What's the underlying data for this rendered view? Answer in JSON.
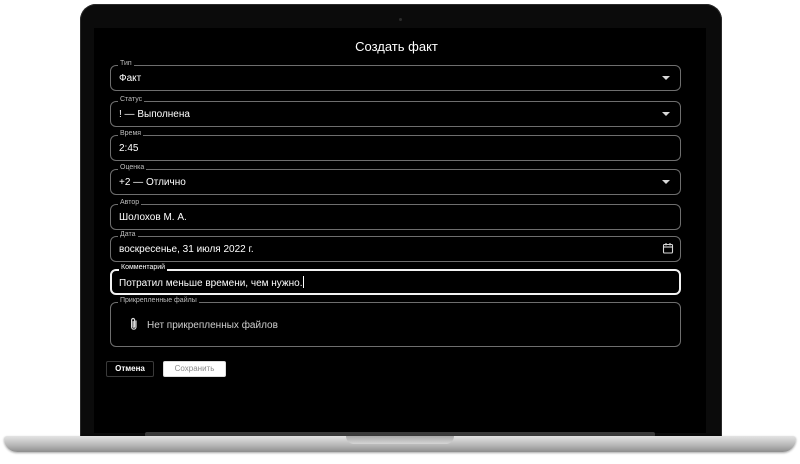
{
  "dialog": {
    "title": "Создать факт"
  },
  "fields": {
    "type": {
      "label": "Тип",
      "value": "Факт"
    },
    "status": {
      "label": "Статус",
      "value": "! — Выполнена"
    },
    "time": {
      "label": "Время",
      "value": "2:45"
    },
    "grade": {
      "label": "Оценка",
      "value": "+2 — Отлично"
    },
    "author": {
      "label": "Автор",
      "value": "Шолохов М. А."
    },
    "date": {
      "label": "Дата",
      "value": "воскресенье, 31 июля 2022 г."
    },
    "comment": {
      "label": "Комментарий",
      "value": "Потратил меньше времени, чем нужно."
    }
  },
  "attachments": {
    "label": "Прикрепленные файлы",
    "empty_text": "Нет прикрепленных файлов"
  },
  "buttons": {
    "cancel": "Отмена",
    "save": "Сохранить"
  },
  "icons": {
    "dropdown": "chevron-down-icon",
    "date": "calendar-icon",
    "attachment": "paperclip-icon"
  }
}
